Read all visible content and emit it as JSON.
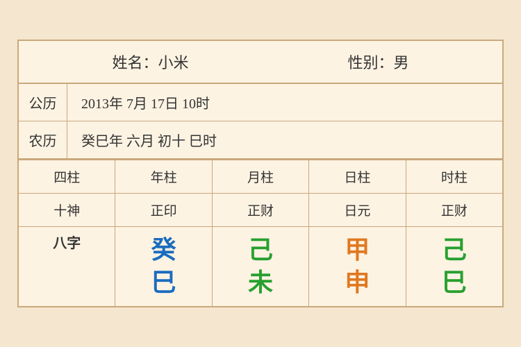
{
  "header": {
    "name_label": "姓名：小米",
    "gender_label": "性别：男"
  },
  "gregorian": {
    "label": "公历",
    "value": "2013年 7月 17日 10时"
  },
  "lunar": {
    "label": "农历",
    "value": "癸巳年 六月 初十 巳时"
  },
  "columns": {
    "row_label": "四柱",
    "headers": [
      "年柱",
      "月柱",
      "日柱",
      "时柱"
    ]
  },
  "shishen": {
    "row_label": "十神",
    "values": [
      "正印",
      "正财",
      "日元",
      "正财"
    ]
  },
  "bazi": {
    "row_label": "八字",
    "top": [
      {
        "char": "癸",
        "color": "blue"
      },
      {
        "char": "己",
        "color": "green"
      },
      {
        "char": "甲",
        "color": "orange"
      },
      {
        "char": "己",
        "color": "green"
      }
    ],
    "bottom": [
      {
        "char": "巳",
        "color": "blue"
      },
      {
        "char": "未",
        "color": "green"
      },
      {
        "char": "申",
        "color": "orange"
      },
      {
        "char": "巳",
        "color": "green"
      }
    ]
  }
}
